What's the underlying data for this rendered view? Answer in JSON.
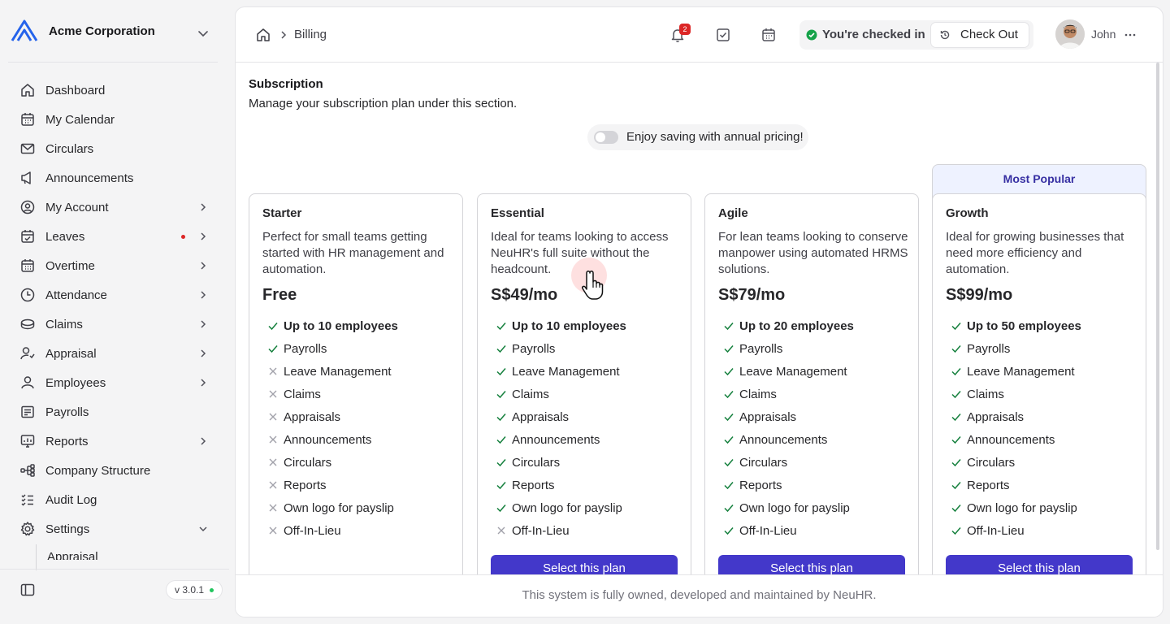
{
  "org": {
    "name": "Acme Corporation",
    "logo_icon": "triangle-logo"
  },
  "sidebar": {
    "items": [
      {
        "label": "Dashboard",
        "icon": "home-icon"
      },
      {
        "label": "My Calendar",
        "icon": "calendar-icon"
      },
      {
        "label": "Circulars",
        "icon": "mail-icon"
      },
      {
        "label": "Announcements",
        "icon": "megaphone-icon"
      },
      {
        "label": "My Account",
        "icon": "user-circle-icon"
      },
      {
        "label": "Leaves",
        "icon": "calendar-check-icon"
      },
      {
        "label": "Overtime",
        "icon": "calendar-clock-icon"
      },
      {
        "label": "Attendance",
        "icon": "clock-icon"
      },
      {
        "label": "Claims",
        "icon": "coins-icon"
      },
      {
        "label": "Appraisal",
        "icon": "user-star-icon"
      },
      {
        "label": "Employees",
        "icon": "user-icon"
      },
      {
        "label": "Payrolls",
        "icon": "receipt-icon"
      },
      {
        "label": "Reports",
        "icon": "chart-icon"
      },
      {
        "label": "Company Structure",
        "icon": "hierarchy-icon"
      },
      {
        "label": "Audit Log",
        "icon": "list-check-icon"
      },
      {
        "label": "Settings",
        "icon": "gear-icon"
      }
    ],
    "submenu_partial": "Appraisals",
    "version": "v 3.0.1"
  },
  "header": {
    "breadcrumb": "Billing",
    "notification_count": "2",
    "checkin_status": "You're checked in",
    "checkout_label": "Check Out",
    "user_name": "John"
  },
  "subscription": {
    "title": "Subscription",
    "description": "Manage your subscription plan under this section.",
    "annual_toggle_label": "Enjoy saving with annual pricing!",
    "annual_enabled": false,
    "most_popular_label": "Most Popular",
    "select_label": "Select this plan",
    "plans": [
      {
        "name": "Starter",
        "description": "Perfect for small teams getting started with HR management and automation.",
        "price": "Free",
        "features": [
          {
            "text": "Up to 10 employees",
            "included": true,
            "bold": true
          },
          {
            "text": "Payrolls",
            "included": true
          },
          {
            "text": "Leave Management",
            "included": false
          },
          {
            "text": "Claims",
            "included": false
          },
          {
            "text": "Appraisals",
            "included": false
          },
          {
            "text": "Announcements",
            "included": false
          },
          {
            "text": "Circulars",
            "included": false
          },
          {
            "text": "Reports",
            "included": false
          },
          {
            "text": "Own logo for payslip",
            "included": false
          },
          {
            "text": "Off-In-Lieu",
            "included": false
          }
        ],
        "has_button": false
      },
      {
        "name": "Essential",
        "description": "Ideal for teams looking to access NeuHR's full suite without the headcount.",
        "price": "S$49/mo",
        "features": [
          {
            "text": "Up to 10 employees",
            "included": true,
            "bold": true
          },
          {
            "text": "Payrolls",
            "included": true
          },
          {
            "text": "Leave Management",
            "included": true
          },
          {
            "text": "Claims",
            "included": true
          },
          {
            "text": "Appraisals",
            "included": true
          },
          {
            "text": "Announcements",
            "included": true
          },
          {
            "text": "Circulars",
            "included": true
          },
          {
            "text": "Reports",
            "included": true
          },
          {
            "text": "Own logo for payslip",
            "included": true
          },
          {
            "text": "Off-In-Lieu",
            "included": false
          }
        ],
        "has_button": true
      },
      {
        "name": "Agile",
        "description": "For lean teams looking to conserve manpower using automated HRMS solutions.",
        "price": "S$79/mo",
        "features": [
          {
            "text": "Up to 20 employees",
            "included": true,
            "bold": true
          },
          {
            "text": "Payrolls",
            "included": true
          },
          {
            "text": "Leave Management",
            "included": true
          },
          {
            "text": "Claims",
            "included": true
          },
          {
            "text": "Appraisals",
            "included": true
          },
          {
            "text": "Announcements",
            "included": true
          },
          {
            "text": "Circulars",
            "included": true
          },
          {
            "text": "Reports",
            "included": true
          },
          {
            "text": "Own logo for payslip",
            "included": true
          },
          {
            "text": "Off-In-Lieu",
            "included": true
          }
        ],
        "has_button": true
      },
      {
        "name": "Growth",
        "description": "Ideal for growing businesses that need more efficiency and automation.",
        "price": "S$99/mo",
        "features": [
          {
            "text": "Up to 50 employees",
            "included": true,
            "bold": true
          },
          {
            "text": "Payrolls",
            "included": true
          },
          {
            "text": "Leave Management",
            "included": true
          },
          {
            "text": "Claims",
            "included": true
          },
          {
            "text": "Appraisals",
            "included": true
          },
          {
            "text": "Announcements",
            "included": true
          },
          {
            "text": "Circulars",
            "included": true
          },
          {
            "text": "Reports",
            "included": true
          },
          {
            "text": "Own logo for payslip",
            "included": true
          },
          {
            "text": "Off-In-Lieu",
            "included": true
          }
        ],
        "has_button": true
      }
    ]
  },
  "footer": {
    "text": "This system is fully owned, developed and maintained by NeuHR."
  },
  "colors": {
    "accent": "#4338ca",
    "check": "#15803d",
    "cross": "#a1a1aa",
    "popular_bg": "#eef2ff",
    "notify": "#dc2626",
    "online": "#22c55e"
  }
}
